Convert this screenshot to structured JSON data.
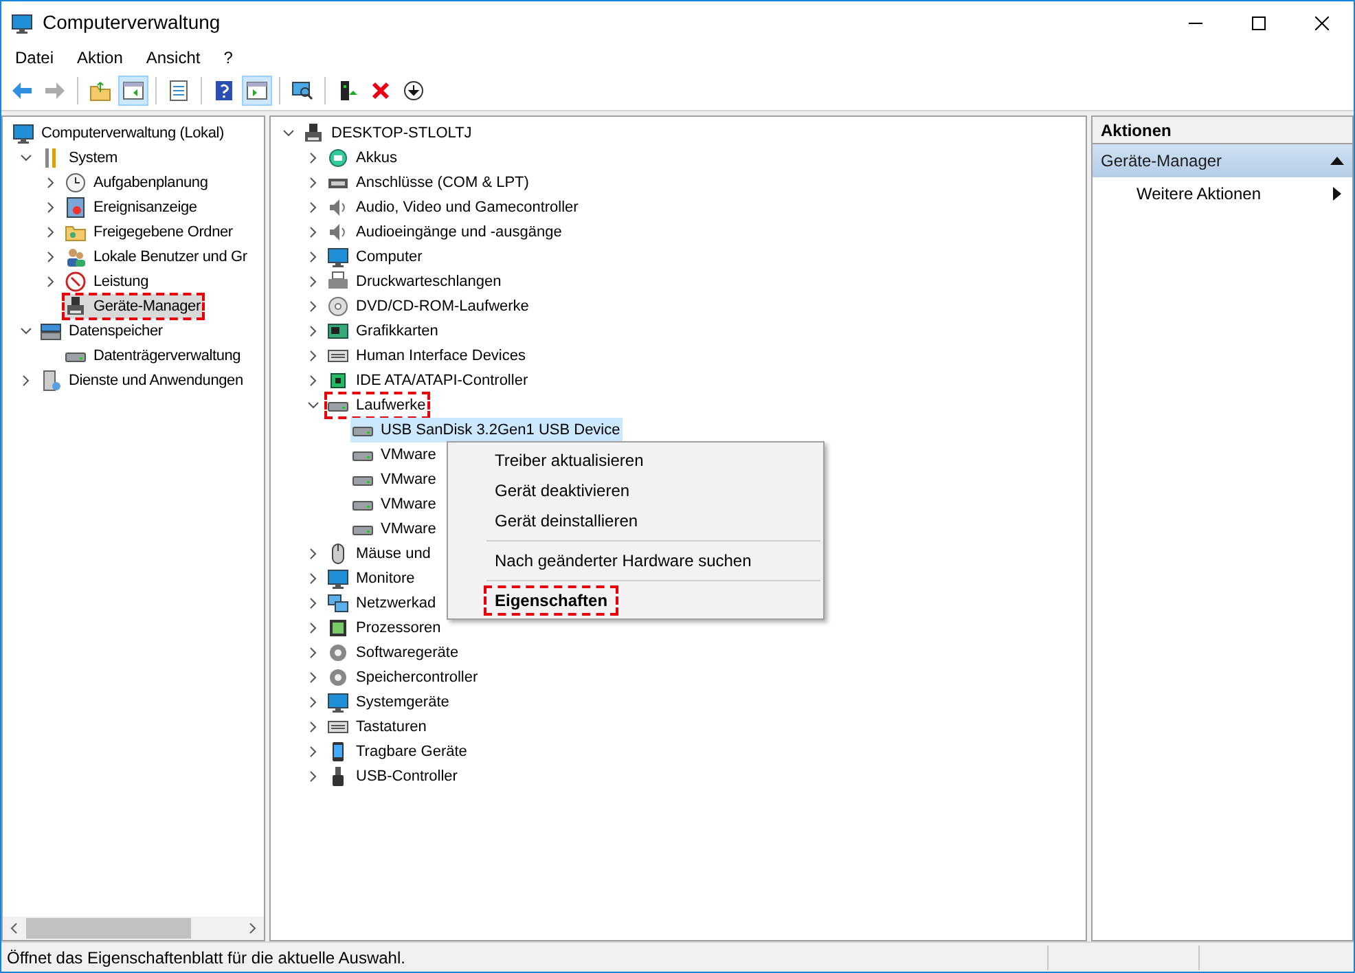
{
  "window": {
    "title": "Computerverwaltung"
  },
  "menu": [
    "Datei",
    "Aktion",
    "Ansicht",
    "?"
  ],
  "toolbar": [
    {
      "pressed": false,
      "disabled": false
    },
    {
      "pressed": false,
      "disabled": true
    },
    {
      "pressed": false,
      "disabled": false
    },
    {
      "pressed": true,
      "disabled": false
    },
    {
      "pressed": false,
      "disabled": false
    },
    {
      "pressed": false,
      "disabled": false
    },
    {
      "pressed": true,
      "disabled": false
    },
    {
      "pressed": false,
      "disabled": false
    },
    {
      "pressed": false,
      "disabled": false
    },
    {
      "pressed": false,
      "disabled": false
    },
    {
      "pressed": false,
      "disabled": false
    }
  ],
  "left_tree": {
    "label": "Computerverwaltung (Lokal)",
    "selected": false,
    "highlighted": false,
    "children": [
      {
        "label": "System",
        "expanded": true,
        "selected": false,
        "highlighted": false,
        "children": [
          {
            "label": "Aufgabenplanung",
            "expanded": false,
            "selected": false,
            "highlighted": false
          },
          {
            "label": "Ereignisanzeige",
            "expanded": false,
            "selected": false,
            "highlighted": false
          },
          {
            "label": "Freigegebene Ordner",
            "expanded": false,
            "selected": false,
            "highlighted": false
          },
          {
            "label": "Lokale Benutzer und Gr",
            "expanded": false,
            "selected": false,
            "highlighted": false
          },
          {
            "label": "Leistung",
            "expanded": false,
            "selected": false,
            "highlighted": false
          },
          {
            "label": "Geräte-Manager",
            "selected": true,
            "highlighted": true
          }
        ]
      },
      {
        "label": "Datenspeicher",
        "expanded": true,
        "selected": false,
        "highlighted": false,
        "children": [
          {
            "label": "Datenträgerverwaltung",
            "selected": false,
            "highlighted": false
          }
        ]
      },
      {
        "label": "Dienste und Anwendungen",
        "expanded": false,
        "selected": false,
        "highlighted": false
      }
    ]
  },
  "device_tree": {
    "label": "DESKTOP-STLOLTJ",
    "expanded": true,
    "selected": false,
    "highlighted": false,
    "children": [
      {
        "label": "Akkus",
        "expanded": false,
        "selected": false,
        "highlighted": false
      },
      {
        "label": "Anschlüsse (COM & LPT)",
        "expanded": false,
        "selected": false,
        "highlighted": false
      },
      {
        "label": "Audio, Video und Gamecontroller",
        "expanded": false,
        "selected": false,
        "highlighted": false
      },
      {
        "label": "Audioeingänge und -ausgänge",
        "expanded": false,
        "selected": false,
        "highlighted": false
      },
      {
        "label": "Computer",
        "expanded": false,
        "selected": false,
        "highlighted": false
      },
      {
        "label": "Druckwarteschlangen",
        "expanded": false,
        "selected": false,
        "highlighted": false
      },
      {
        "label": "DVD/CD-ROM-Laufwerke",
        "expanded": false,
        "selected": false,
        "highlighted": false
      },
      {
        "label": "Grafikkarten",
        "expanded": false,
        "selected": false,
        "highlighted": false
      },
      {
        "label": "Human Interface Devices",
        "expanded": false,
        "selected": false,
        "highlighted": false
      },
      {
        "label": "IDE ATA/ATAPI-Controller",
        "expanded": false,
        "selected": false,
        "highlighted": false
      },
      {
        "label": "Laufwerke",
        "expanded": true,
        "selected": false,
        "highlighted": true,
        "children": [
          {
            "label": "USB  SanDisk 3.2Gen1 USB Device",
            "selected": true,
            "highlighted": false
          },
          {
            "label": "VMware",
            "selected": false,
            "highlighted": false
          },
          {
            "label": "VMware",
            "selected": false,
            "highlighted": false
          },
          {
            "label": "VMware",
            "selected": false,
            "highlighted": false
          },
          {
            "label": "VMware",
            "selected": false,
            "highlighted": false
          }
        ]
      },
      {
        "label": "Mäuse und",
        "expanded": false,
        "selected": false,
        "highlighted": false
      },
      {
        "label": "Monitore",
        "expanded": false,
        "selected": false,
        "highlighted": false
      },
      {
        "label": "Netzwerkad",
        "expanded": false,
        "selected": false,
        "highlighted": false
      },
      {
        "label": "Prozessoren",
        "expanded": false,
        "selected": false,
        "highlighted": false
      },
      {
        "label": "Softwaregeräte",
        "expanded": false,
        "selected": false,
        "highlighted": false
      },
      {
        "label": "Speichercontroller",
        "expanded": false,
        "selected": false,
        "highlighted": false
      },
      {
        "label": "Systemgeräte",
        "expanded": false,
        "selected": false,
        "highlighted": false
      },
      {
        "label": "Tastaturen",
        "expanded": false,
        "selected": false,
        "highlighted": false
      },
      {
        "label": "Tragbare Geräte",
        "expanded": false,
        "selected": false,
        "highlighted": false
      },
      {
        "label": "USB-Controller",
        "expanded": false,
        "selected": false,
        "highlighted": false
      }
    ]
  },
  "context_menu": {
    "items": [
      {
        "kind": "item",
        "label": "Treiber aktualisieren",
        "default": false,
        "highlighted": false
      },
      {
        "kind": "item",
        "label": "Gerät deaktivieren",
        "default": false,
        "highlighted": false
      },
      {
        "kind": "item",
        "label": "Gerät deinstallieren",
        "default": false,
        "highlighted": false
      },
      {
        "kind": "separator"
      },
      {
        "kind": "item",
        "label": "Nach geänderter Hardware suchen",
        "default": false,
        "highlighted": false
      },
      {
        "kind": "separator"
      },
      {
        "kind": "item",
        "label": "Eigenschaften",
        "default": true,
        "highlighted": true
      }
    ]
  },
  "actions": {
    "title": "Aktionen",
    "section": {
      "label": "Geräte-Manager",
      "expanded": true
    },
    "items": [
      {
        "label": "Weitere Aktionen"
      }
    ]
  },
  "status_bar": {
    "text": "Öffnet das Eigenschaftenblatt für die aktuelle Auswahl."
  }
}
